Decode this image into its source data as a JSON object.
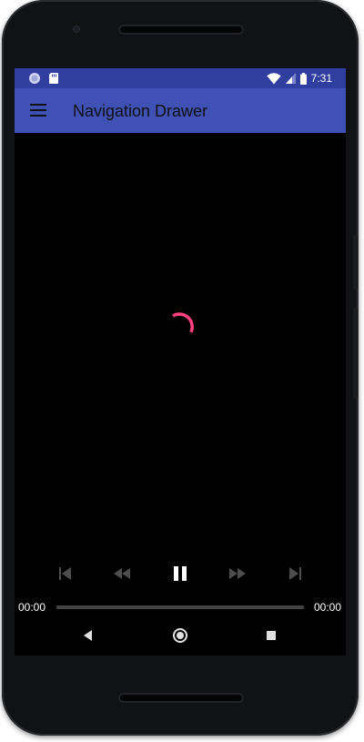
{
  "status_bar": {
    "time": "7:31",
    "left_icons": [
      "notification-icon",
      "sd-card-icon"
    ],
    "right_icons": [
      "wifi-icon",
      "cell-signal-icon",
      "battery-icon"
    ]
  },
  "app_bar": {
    "menu_icon": "menu-icon",
    "title": "Navigation Drawer"
  },
  "player": {
    "loading": true,
    "controls": [
      "skip-previous-icon",
      "rewind-icon",
      "pause-icon",
      "fast-forward-icon",
      "skip-next-icon"
    ],
    "position": "00:00",
    "duration": "00:00",
    "progress": 0
  },
  "nav_bar": {
    "buttons": [
      "back-icon",
      "home-icon",
      "recents-icon"
    ]
  },
  "colors": {
    "status_bar": "#303f9f",
    "app_bar": "#3f51b5",
    "spinner": "#ff4081",
    "screen_bg": "#000000"
  }
}
